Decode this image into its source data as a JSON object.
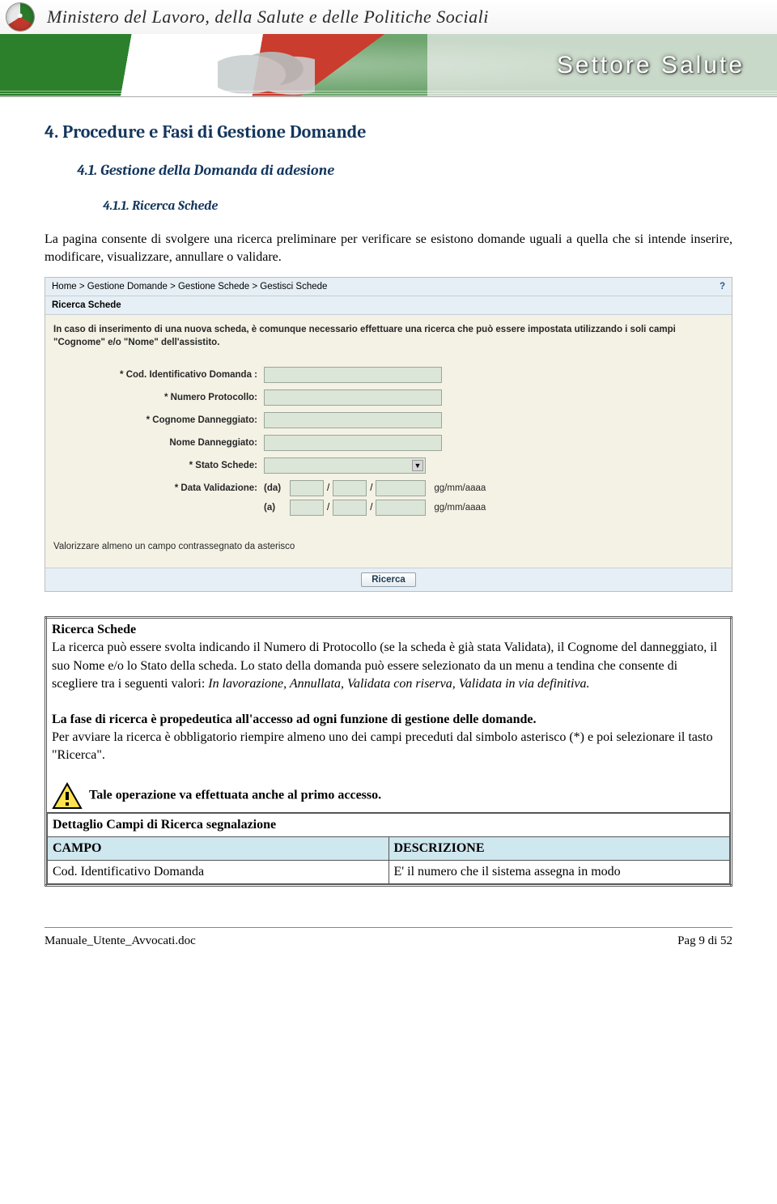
{
  "banner": {
    "ministry": "Ministero del Lavoro, della Salute e delle Politiche Sociali",
    "sector": "Settore Salute"
  },
  "headings": {
    "h2": "4. Procedure e Fasi di Gestione Domande",
    "h3": "4.1.    Gestione della Domanda di adesione",
    "h4": "4.1.1. Ricerca Schede"
  },
  "intro": "La pagina consente di svolgere una ricerca preliminare per verificare se esistono domande uguali a quella che si intende inserire, modificare, visualizzare, annullare o validare.",
  "app": {
    "breadcrumb": "Home > Gestione Domande > Gestione Schede > Gestisci Schede",
    "help": "?",
    "panel_title": "Ricerca Schede",
    "instructions": "In caso di inserimento di una nuova scheda, è comunque necessario effettuare una ricerca che può essere impostata utilizzando i soli campi \"Cognome\" e/o \"Nome\" dell'assistito.",
    "labels": {
      "cod": "* Cod. Identificativo Domanda :",
      "protocollo": "* Numero Protocollo:",
      "cognome": "* Cognome Danneggiato:",
      "nome": "Nome Danneggiato:",
      "stato": "* Stato Schede:",
      "validazione": "* Data Validazione:"
    },
    "date": {
      "da": "(da)",
      "a": "(a)",
      "fmt": "gg/mm/aaaa",
      "sep": "/"
    },
    "note": "Valorizzare almeno un campo contrassegnato da asterisco",
    "button": "Ricerca"
  },
  "box": {
    "title": "Ricerca Schede",
    "para1a": "La ricerca può essere svolta indicando il Numero di Protocollo (se la scheda è già stata Validata), il Cognome del danneggiato, il suo Nome e/o lo Stato della scheda. Lo stato della domanda può essere selezionato da un menu a tendina che consente di scegliere tra i seguenti valori: ",
    "para1b": "In lavorazione, Annullata, Validata con riserva, Validata in via definitiva.",
    "para2_bold": "La fase di ricerca è propedeutica all'accesso ad ogni funzione di gestione delle domande.",
    "para2_rest": "Per avviare la ricerca è obbligatorio riempire almeno uno dei campi preceduti dal simbolo asterisco (*) e poi selezionare il tasto \"Ricerca\".",
    "warn": "Tale operazione va effettuata anche al primo accesso.",
    "detail_title": "Dettaglio Campi di Ricerca segnalazione",
    "col1": "CAMPO",
    "col2": "DESCRIZIONE",
    "row1_field": "Cod. Identificativo Domanda",
    "row1_desc": "E' il numero che il sistema assegna in modo"
  },
  "footer": {
    "left": "Manuale_Utente_Avvocati.doc",
    "right": "Pag 9 di 52"
  }
}
